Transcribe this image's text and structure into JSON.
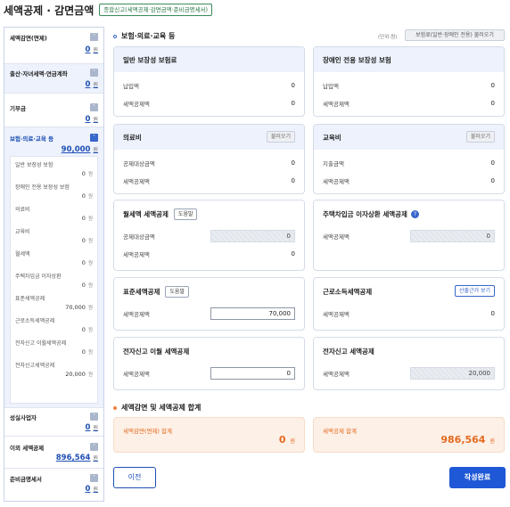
{
  "header": {
    "title": "세액공제 · 감면금액",
    "badge": "종합신고(세액공제·감면금액·준비금명세서)"
  },
  "sidebar": {
    "groups": [
      {
        "label": "세액감면(면제)",
        "value": "0",
        "won": "원",
        "checked": false
      },
      {
        "label": "출산·자녀세액·연금계좌",
        "value": "0",
        "won": "원",
        "checked": false
      },
      {
        "label": "기부금",
        "value": "0",
        "won": "원",
        "checked": false
      },
      {
        "label": "보험·의료·교육 등",
        "value": "90,000",
        "won": "원",
        "checked": true
      },
      {
        "label": "성실사업자",
        "value": "0",
        "won": "원",
        "checked": false
      },
      {
        "label": "이외 세액공제",
        "value": "896,564",
        "won": "원",
        "checked": false
      },
      {
        "label": "준비금명세서",
        "value": "0",
        "won": "원",
        "checked": false
      }
    ],
    "sub_items": [
      {
        "label": "일반 보장성 보험",
        "value": "0",
        "won": "원"
      },
      {
        "label": "장애인 전용 보장성 보험",
        "value": "0",
        "won": "원"
      },
      {
        "label": "의료비",
        "value": "0",
        "won": "원"
      },
      {
        "label": "교육비",
        "value": "0",
        "won": "원"
      },
      {
        "label": "월세액",
        "value": "0",
        "won": "원"
      },
      {
        "label": "주택차입금 이자상환",
        "value": "0",
        "won": "원"
      },
      {
        "label": "표준세액공제",
        "value": "70,000",
        "won": "원"
      },
      {
        "label": "근로소득세액공제",
        "value": "0",
        "won": "원"
      },
      {
        "label": "전자신고 이월세액공제",
        "value": "0",
        "won": "원"
      },
      {
        "label": "전자신고세액공제",
        "value": "20,000",
        "won": "원"
      }
    ]
  },
  "section1": {
    "title": "보험·의료·교육 등",
    "unit": "(단위:원)",
    "load_all": "보험료(일반·장애인 전용) 불러오기"
  },
  "cards": {
    "general_insurance": {
      "title": "일반 보장성 보험료",
      "r1": "납입액",
      "v1": "0",
      "r2": "세액공제액",
      "v2": "0"
    },
    "disabled_insurance": {
      "title": "장애인 전용 보장성 보험",
      "r1": "납입액",
      "v1": "0",
      "r2": "세액공제액",
      "v2": "0"
    },
    "medical": {
      "title": "의료비",
      "btn": "불러오기",
      "r1": "공제대상금액",
      "v1": "0",
      "r2": "세액공제액",
      "v2": "0"
    },
    "education": {
      "title": "교육비",
      "btn": "불러오기",
      "r1": "지출금액",
      "v1": "0",
      "r2": "세액공제액",
      "v2": "0"
    },
    "monthly_rent": {
      "title": "월세액 세액공제",
      "btn": "도움말",
      "r1": "공제대상금액",
      "v1": "0",
      "r2": "세액공제액",
      "v2": "0"
    },
    "housing_loan": {
      "title": "주택차입금 이자상환 세액공제",
      "r1": "세액공제액",
      "v1": "0"
    },
    "standard": {
      "title": "표준세액공제",
      "btn": "도움말",
      "r1": "세액공제액",
      "v1": "70,000"
    },
    "earned_income": {
      "title": "근로소득세액공제",
      "btn": "산출근거 보기",
      "r1": "세액공제액",
      "v1": "0"
    },
    "efiling_carry": {
      "title": "전자신고 이월 세액공제",
      "r1": "세액공제액",
      "v1": "0"
    },
    "efiling": {
      "title": "전자신고 세액공제",
      "r1": "세액공제액",
      "v1": "20,000"
    }
  },
  "section2": {
    "title": "세액감면 및 세액공제 합계"
  },
  "totals": {
    "reduction": {
      "label": "세액감면(면제) 합계",
      "value": "0",
      "won": "원"
    },
    "credit": {
      "label": "세액공제 합계",
      "value": "986,564",
      "won": "원"
    }
  },
  "footer": {
    "prev": "이전",
    "done": "작성완료"
  },
  "colors": {
    "accent": "#1f58d6",
    "total": "#e26a20"
  }
}
